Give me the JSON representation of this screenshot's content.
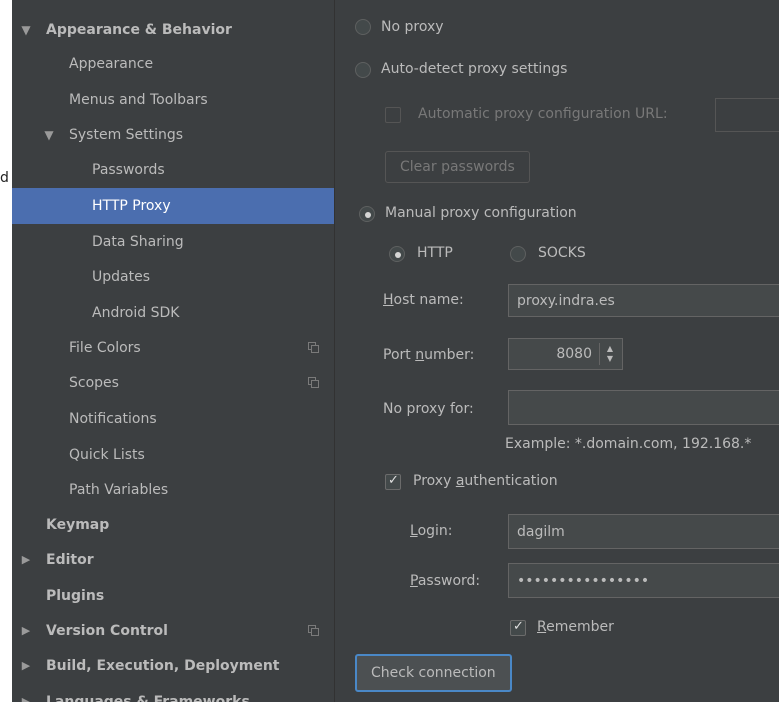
{
  "edge_char": "d",
  "sidebar": {
    "items": [
      {
        "label": "Appearance & Behavior",
        "bold": true,
        "arrow": "▼"
      },
      {
        "label": "Appearance"
      },
      {
        "label": "Menus and Toolbars"
      },
      {
        "label": "System Settings",
        "arrow": "▼"
      },
      {
        "label": "Passwords"
      },
      {
        "label": "HTTP Proxy",
        "selected": true
      },
      {
        "label": "Data Sharing"
      },
      {
        "label": "Updates"
      },
      {
        "label": "Android SDK"
      },
      {
        "label": "File Colors",
        "icon": "copy-icon"
      },
      {
        "label": "Scopes",
        "icon": "copy-icon"
      },
      {
        "label": "Notifications"
      },
      {
        "label": "Quick Lists"
      },
      {
        "label": "Path Variables"
      },
      {
        "label": "Keymap",
        "bold": true
      },
      {
        "label": "Editor",
        "bold": true,
        "arrow": "▶"
      },
      {
        "label": "Plugins",
        "bold": true
      },
      {
        "label": "Version Control",
        "bold": true,
        "arrow": "▶",
        "icon": "copy-icon"
      },
      {
        "label": "Build, Execution, Deployment",
        "bold": true,
        "arrow": "▶"
      },
      {
        "label": "Languages & Frameworks",
        "bold": true,
        "arrow": "▶"
      }
    ]
  },
  "proxy": {
    "no_proxy": "No proxy",
    "auto_detect": "Auto-detect proxy settings",
    "auto_config_url": "Automatic proxy configuration URL:",
    "auto_config_url_value": "",
    "clear_passwords": "Clear passwords",
    "manual": "Manual proxy configuration",
    "http": "HTTP",
    "socks": "SOCKS",
    "host_label_m": "H",
    "host_label_rest": "ost name:",
    "host_value": "proxy.indra.es",
    "port_label_a": "Port ",
    "port_label_m": "n",
    "port_label_rest": "umber:",
    "port_value": "8080",
    "no_proxy_for_label": "No proxy for:",
    "no_proxy_for_value": "",
    "example": "Example: *.domain.com, 192.168.*",
    "auth_a": "Proxy ",
    "auth_m": "a",
    "auth_rest": "uthentication",
    "login_m": "L",
    "login_rest": "ogin:",
    "login_value": "dagilm",
    "password_m": "P",
    "password_rest": "assword:",
    "password_value": "••••••••••••••••",
    "remember_m": "R",
    "remember_rest": "emember",
    "check_connection": "Check connection"
  }
}
